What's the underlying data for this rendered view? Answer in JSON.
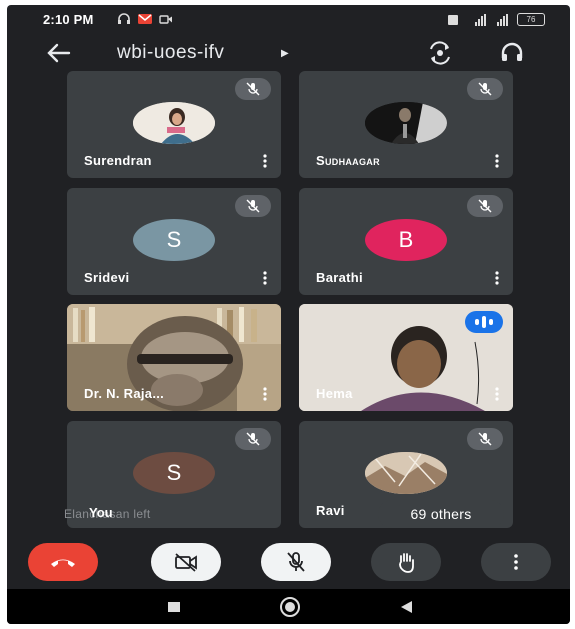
{
  "status_bar": {
    "time": "2:10 PM",
    "battery": "76"
  },
  "meeting": {
    "code": "wbi-uoes-ifv"
  },
  "participants": [
    {
      "name": "Surendran",
      "type": "photo",
      "muted": true
    },
    {
      "name": "Sudhaagar",
      "type": "photo",
      "muted": true
    },
    {
      "name": "Sridevi",
      "type": "initial",
      "initial": "S",
      "color": "#7a96a3",
      "muted": true
    },
    {
      "name": "Barathi",
      "type": "initial",
      "initial": "B",
      "color": "#e0245e",
      "muted": true
    },
    {
      "name": "Dr. N. Raja...",
      "type": "video",
      "muted": false
    },
    {
      "name": "Hema",
      "type": "video",
      "speaking": true
    },
    {
      "name": "You",
      "type": "initial",
      "initial": "S",
      "color": "#6d4c41",
      "muted": true
    },
    {
      "name": "Ravi",
      "type": "photo",
      "muted": true
    }
  ],
  "others": {
    "label": "69 others"
  },
  "toast": {
    "text": "Elanchasan left"
  },
  "controls": {
    "end_call": {
      "color": "#ea4335",
      "icon": "phone-hangup-icon"
    },
    "camera": {
      "icon": "camera-off-icon"
    },
    "mic": {
      "icon": "mic-off-icon"
    },
    "raise_hand": {
      "icon": "hand-icon"
    },
    "more": {
      "icon": "more-vert-icon"
    }
  },
  "colors": {
    "background": "#202124",
    "tile": "#3c4043",
    "accent": "#1a73e8"
  }
}
